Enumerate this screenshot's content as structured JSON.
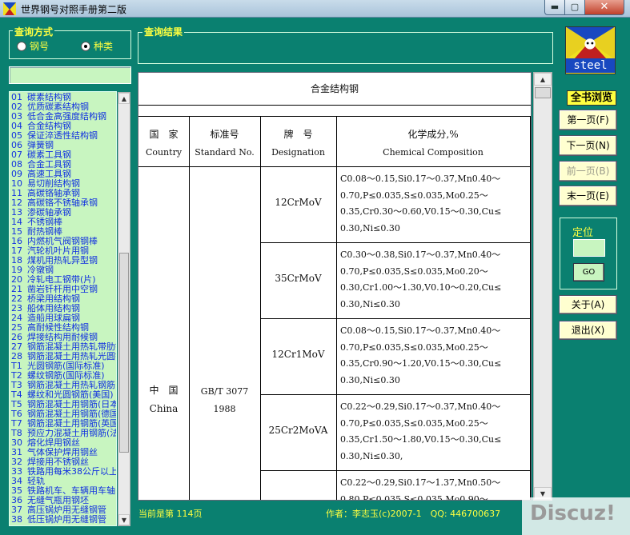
{
  "window": {
    "title": "世界钢号对照手册第二版",
    "min_glyph": "▬",
    "max_glyph": "▢",
    "close_glyph": "✕"
  },
  "query_mode": {
    "label": "查询方式",
    "options": [
      "钢号",
      "种类"
    ],
    "selected": "种类"
  },
  "results_label": "查询结果",
  "categories": [
    {
      "num": "01",
      "name": "碳素结构钢"
    },
    {
      "num": "02",
      "name": "优质碳素结构钢"
    },
    {
      "num": "03",
      "name": "低合金高强度结构钢"
    },
    {
      "num": "04",
      "name": "合金结构钢"
    },
    {
      "num": "05",
      "name": "保证淬透性结构钢"
    },
    {
      "num": "06",
      "name": "弹簧钢"
    },
    {
      "num": "07",
      "name": "碳素工具钢"
    },
    {
      "num": "08",
      "name": "合金工具钢"
    },
    {
      "num": "09",
      "name": "高速工具钢"
    },
    {
      "num": "10",
      "name": "易切削结构钢"
    },
    {
      "num": "11",
      "name": "高碳铬轴承钢"
    },
    {
      "num": "12",
      "name": "高碳铬不锈轴承钢"
    },
    {
      "num": "13",
      "name": "渗碳轴承钢"
    },
    {
      "num": "14",
      "name": "不锈钢棒"
    },
    {
      "num": "15",
      "name": "耐热钢棒"
    },
    {
      "num": "16",
      "name": "内燃机气阀钢钢棒"
    },
    {
      "num": "17",
      "name": "汽轮机叶片用钢"
    },
    {
      "num": "18",
      "name": "煤机用热轧异型钢"
    },
    {
      "num": "19",
      "name": "冷镦钢"
    },
    {
      "num": "20",
      "name": "冷轧电工钢带(片)"
    },
    {
      "num": "21",
      "name": "凿岩钎杆用中空钢"
    },
    {
      "num": "22",
      "name": "桥梁用结构钢"
    },
    {
      "num": "23",
      "name": "船体用结构钢"
    },
    {
      "num": "24",
      "name": "造船用球扁钢"
    },
    {
      "num": "25",
      "name": "高耐候性结构钢"
    },
    {
      "num": "26",
      "name": "焊接结构用耐候钢"
    },
    {
      "num": "27",
      "name": "钢筋混凝土用热轧带肋钢筋"
    },
    {
      "num": "28",
      "name": "钢筋混凝土用热轧光圆钢筋"
    },
    {
      "num": "T1",
      "name": "光圆钢筋(国际标准)"
    },
    {
      "num": "T2",
      "name": "螺纹钢筋(国际标准)"
    },
    {
      "num": "T3",
      "name": "钢筋混凝土用热轧钢筋"
    },
    {
      "num": "T4",
      "name": "螺纹和光圆钢筋(美国)"
    },
    {
      "num": "T5",
      "name": "钢筋混凝土用钢筋(日本)"
    },
    {
      "num": "T6",
      "name": "钢筋混凝土用钢筋(德国)"
    },
    {
      "num": "T7",
      "name": "钢筋混凝土用钢筋(英国)"
    },
    {
      "num": "T8",
      "name": "预应力混凝土用钢筋(法国)"
    },
    {
      "num": "30",
      "name": "熔化焊用钢丝"
    },
    {
      "num": "31",
      "name": "气体保护焊用钢丝"
    },
    {
      "num": "32",
      "name": "焊接用不锈钢丝"
    },
    {
      "num": "33",
      "name": "铁路用每米38公斤以上钢轨"
    },
    {
      "num": "34",
      "name": "轻轨"
    },
    {
      "num": "35",
      "name": "铁路机车、车辆用车轴"
    },
    {
      "num": "36",
      "name": "无缝气瓶用钢坯"
    },
    {
      "num": "37",
      "name": "高压锅炉用无缝钢管"
    },
    {
      "num": "38",
      "name": "低压锅炉用无缝钢管"
    }
  ],
  "document": {
    "title": "合金结构钢",
    "headers": {
      "country": {
        "cn": "国　家",
        "en": "Country"
      },
      "standard": {
        "cn": "标准号",
        "en": "Standard No."
      },
      "designation": {
        "cn": "牌　号",
        "en": "Designation"
      },
      "chemical": {
        "cn": "化学成分,%",
        "en": "Chemical Composition"
      }
    },
    "country": {
      "cn": "中　国",
      "en": "China"
    },
    "standard_no": "GB/T 3077",
    "standard_year": "1988",
    "rows": [
      {
        "grade": "12CrMoV",
        "chem": [
          "C0.08～0.15,Si0.17～0.37,Mn0.40～",
          "0.70,P≤0.035,S≤0.035,Mo0.25～",
          "0.35,Cr0.30～0.60,V0.15～0.30,Cu≤",
          "0.30,Ni≤0.30"
        ]
      },
      {
        "grade": "35CrMoV",
        "chem": [
          "C0.30～0.38,Si0.17～0.37,Mn0.40～",
          "0.70,P≤0.035,S≤0.035,Mo0.20～",
          "0.30,Cr1.00～1.30,V0.10～0.20,Cu≤",
          "0.30,Ni≤0.30"
        ]
      },
      {
        "grade": "12Cr1MoV",
        "chem": [
          "C0.08～0.15,Si0.17～0.37,Mn0.40～",
          "0.70,P≤0.035,S≤0.035,Mo0.25～",
          "0.35,Cr0.90～1.20,V0.15～0.30,Cu≤",
          "0.30,Ni≤0.30"
        ]
      },
      {
        "grade": "25Cr2MoVA",
        "chem": [
          "C0.22～0.29,Si0.17～0.37,Mn0.40～",
          "0.70,P≤0.035,S≤0.035,Mo0.25～",
          "0.35,Cr1.50～1.80,V0.15～0.30,Cu≤",
          "0.30,Ni≤0.30,"
        ]
      },
      {
        "grade": "",
        "chem": [
          "C0.22～0.29,Si0.17～1.37,Mn0.50～",
          "0.80,P≤0.035,S≤0.035,Mo0.90～"
        ]
      }
    ]
  },
  "right_panel": {
    "logo_text": "steel",
    "browse_label": "全书浏览",
    "buttons": {
      "first": "第一页(F)",
      "next": "下一页(N)",
      "prev": "前一页(B)",
      "last": "末一页(E)",
      "about": "关于(A)",
      "exit": "退出(X)"
    },
    "locate_label": "定位",
    "go_label": "GO"
  },
  "status": {
    "page": "当前是第 114页",
    "author": "作者：李志玉(c)2007-1　QQ: 446700637"
  },
  "watermark": "Discuz!",
  "colors": {
    "background": "#0a8070",
    "list_bg": "#c8f5c0",
    "label_yellow": "#ffff40",
    "list_text": "#1030e0"
  }
}
